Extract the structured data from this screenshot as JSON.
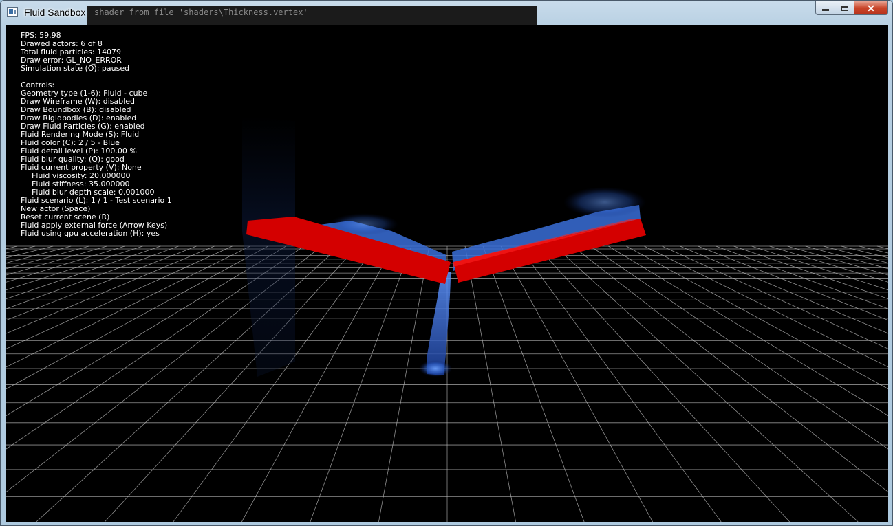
{
  "window": {
    "title": "Fluid Sandbox",
    "background_console_text": "shader from file 'shaders\\Thickness.vertex'",
    "buttons": {
      "minimize": "minimize",
      "maximize": "maximize",
      "close": "✕"
    }
  },
  "hud": {
    "fps": "FPS: 59.98",
    "drawed_actors": "Drawed actors: 6 of 8",
    "total_particles": "Total fluid particles: 14079",
    "draw_error": "Draw error: GL_NO_ERROR",
    "simulation_state": "Simulation state (O): paused",
    "controls_header": "Controls:",
    "controls": [
      "Geometry type (1-6): Fluid - cube",
      "Draw Wireframe (W): disabled",
      "Draw Boundbox (B): disabled",
      "Draw Rigidbodies (D): enabled",
      "Draw Fluid Particles (G): enabled",
      "Fluid Rendering Mode (S): Fluid",
      "Fluid color (C): 2 / 5 - Blue",
      "Fluid detail level (P): 100.00 %",
      "Fluid blur quality: (Q): good",
      "Fluid current property (V): None"
    ],
    "properties": [
      "Fluid viscosity: 20.000000",
      "Fluid stiffness: 35.000000",
      "Fluid blur depth scale: 0.001000"
    ],
    "controls_tail": [
      "Fluid scenario (L): 1 / 1 - Test scenario 1",
      "New actor (Space)",
      "Reset current scene (R)",
      "Fluid apply external force (Arrow Keys)",
      "Fluid using gpu acceleration (H): yes"
    ]
  },
  "scene": {
    "colors": {
      "background": "#000000",
      "grid": "#bfbfbf",
      "rigidbody": "#d40000",
      "fluid": "#2c5ec8"
    }
  }
}
